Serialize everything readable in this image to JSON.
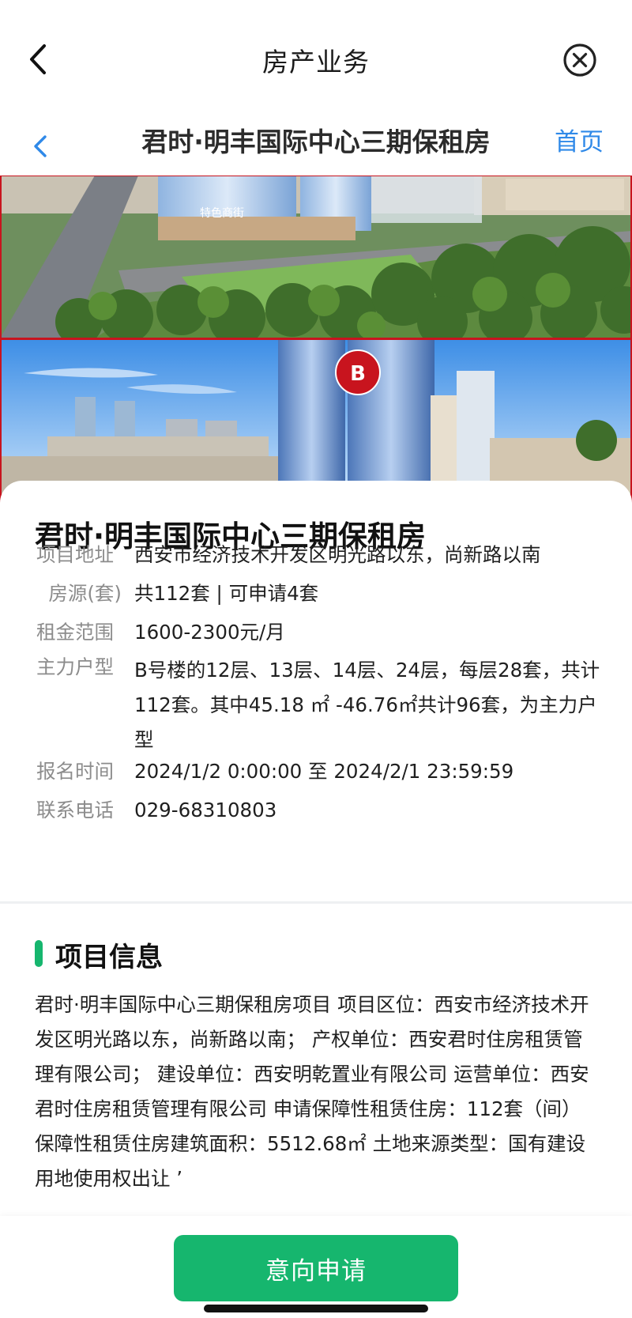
{
  "nav": {
    "title": "房产业务",
    "back_icon": "back-chevron-icon",
    "close_icon": "close-circle-icon"
  },
  "subnav": {
    "title": "君时·明丰国际中心三期保租房",
    "home_label": "首页",
    "accent": "#2f89e8"
  },
  "hero": {
    "sign_text": "特色商街",
    "marker_label": "B",
    "marker_color": "#c8141e"
  },
  "project": {
    "name": "君时·明丰国际中心三期保租房",
    "rows": [
      {
        "label": "项目地址",
        "value": "西安市经济技术开发区明光路以东，尚新路以南"
      },
      {
        "label": "房源(套)",
        "value": "共112套 | 可申请4套"
      },
      {
        "label": "租金范围",
        "value": "1600-2300元/月"
      },
      {
        "label": "主力户型",
        "value": "B号楼的12层、13层、14层、24层，每层28套，共计112套。其中45.18 ㎡ -46.76㎡共计96套，为主力户型"
      },
      {
        "label": "报名时间",
        "value": "2024/1/2 0:00:00 至 2024/2/1 23:59:59"
      },
      {
        "label": "联系电话",
        "value": "029-68310803"
      }
    ]
  },
  "info": {
    "heading": "项目信息",
    "text": "君时·明丰国际中心三期保租房项目 项目区位：西安市经济技术开发区明光路以东，尚新路以南； 产权单位：西安君时住房租赁管理有限公司； 建设单位：西安明乾置业有限公司 运营单位：西安君时住房租赁管理有限公司 申请保障性租赁住房：112套（间） 保障性租赁住房建筑面积：5512.68㎡ 土地来源类型：国有建设用地使用权出让 ’"
  },
  "footer": {
    "apply_label": "意向申请",
    "accent": "#16b66e"
  }
}
